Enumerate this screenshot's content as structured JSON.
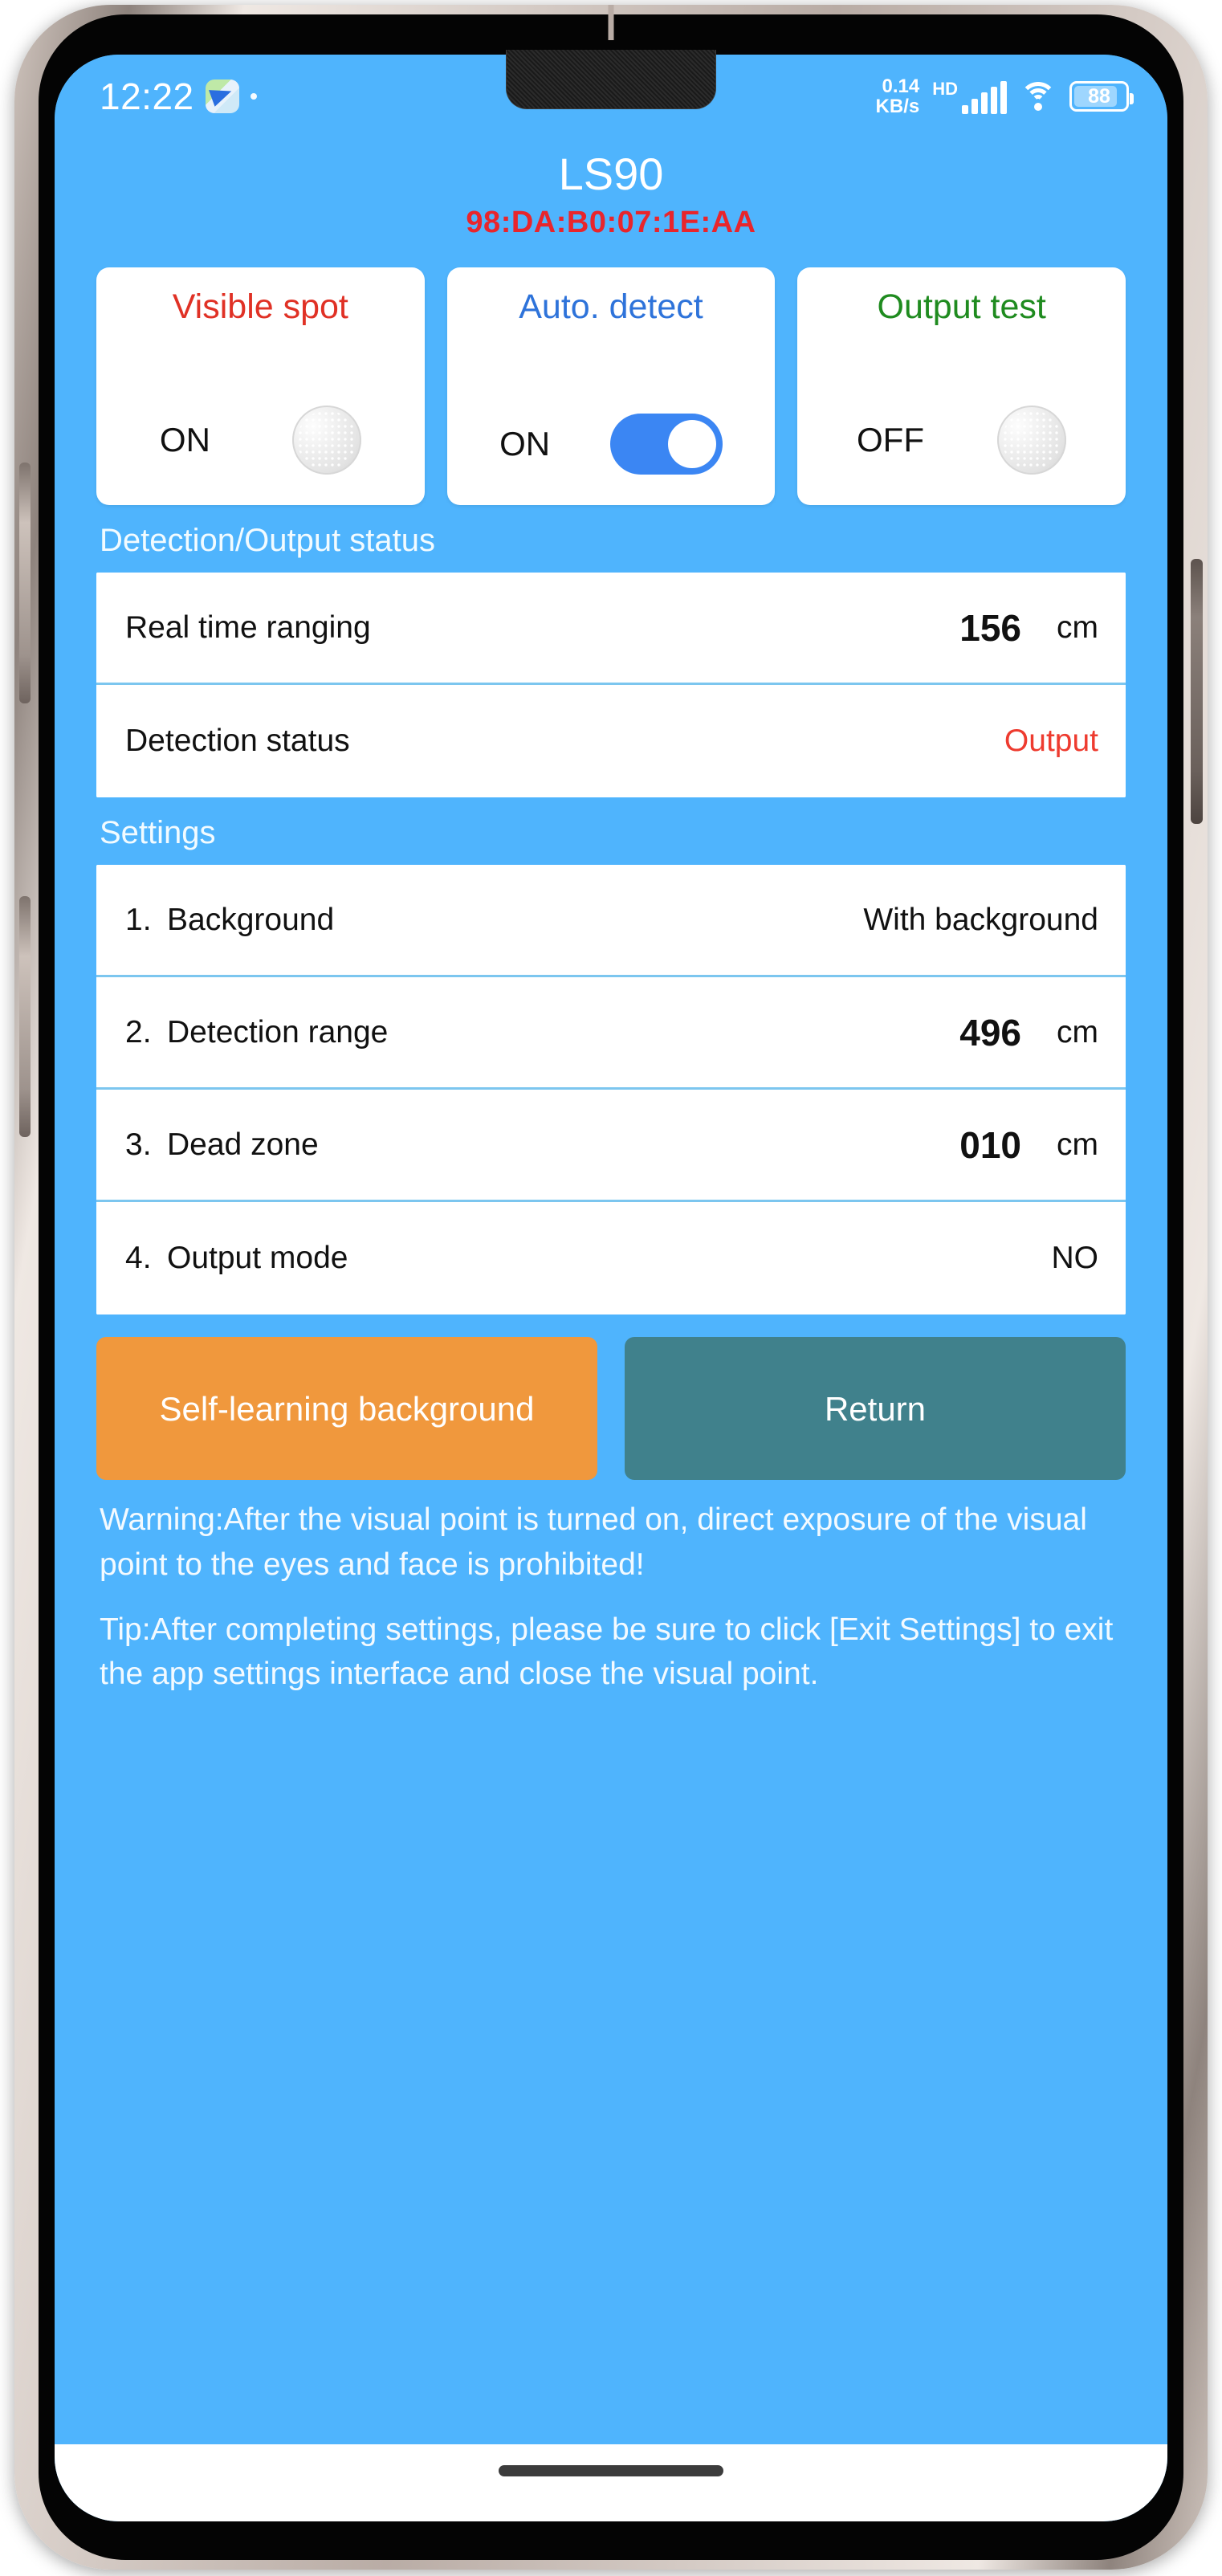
{
  "statusbar": {
    "time": "12:22",
    "nav_app_icon": "navigation-app-icon",
    "data_speed": "0.14",
    "data_speed_unit": "KB/s",
    "network_type": "HD",
    "signal_icon": "signal-bars-icon",
    "wifi_icon": "wifi-icon",
    "battery_level": "88"
  },
  "header": {
    "device_name": "LS90",
    "device_mac": "98:DA:B0:07:1E:AA"
  },
  "cards": [
    {
      "title": "Visible spot",
      "state": "ON",
      "switch_type": "grey-knob",
      "color": "#e03125"
    },
    {
      "title": "Auto. detect",
      "state": "ON",
      "switch_type": "blue-toggle-on",
      "color": "#2e73da"
    },
    {
      "title": "Output test",
      "state": "OFF",
      "switch_type": "grey-knob",
      "color": "#1f8b1f"
    }
  ],
  "status_section": {
    "heading": "Detection/Output status",
    "rows": [
      {
        "label": "Real time ranging",
        "value": "156",
        "unit": "cm"
      },
      {
        "label": "Detection status",
        "value": "Output",
        "unit": ""
      }
    ]
  },
  "settings_section": {
    "heading": "Settings",
    "rows": [
      {
        "num": "1.",
        "label": "Background",
        "value": "With background",
        "unit": ""
      },
      {
        "num": "2.",
        "label": "Detection range",
        "value": "496",
        "unit": "cm"
      },
      {
        "num": "3.",
        "label": "Dead zone",
        "value": "010",
        "unit": "cm"
      },
      {
        "num": "4.",
        "label": "Output mode",
        "value": "NO",
        "unit": ""
      }
    ]
  },
  "actions": {
    "self_learning_label": "Self-learning background",
    "return_label": "Return"
  },
  "notes": {
    "warning": "Warning:After the visual point is turned on, direct exposure of the visual point to the eyes and face is prohibited!",
    "tip": "Tip:After completing settings, please be sure to click [Exit Settings] to exit the app settings interface and close the visual point."
  },
  "colors": {
    "background_blue": "#4fb4fd",
    "accent_red": "#e8252c",
    "accent_orange": "#f0983d",
    "accent_teal": "#40818c",
    "toggle_blue": "#3b86f3"
  }
}
